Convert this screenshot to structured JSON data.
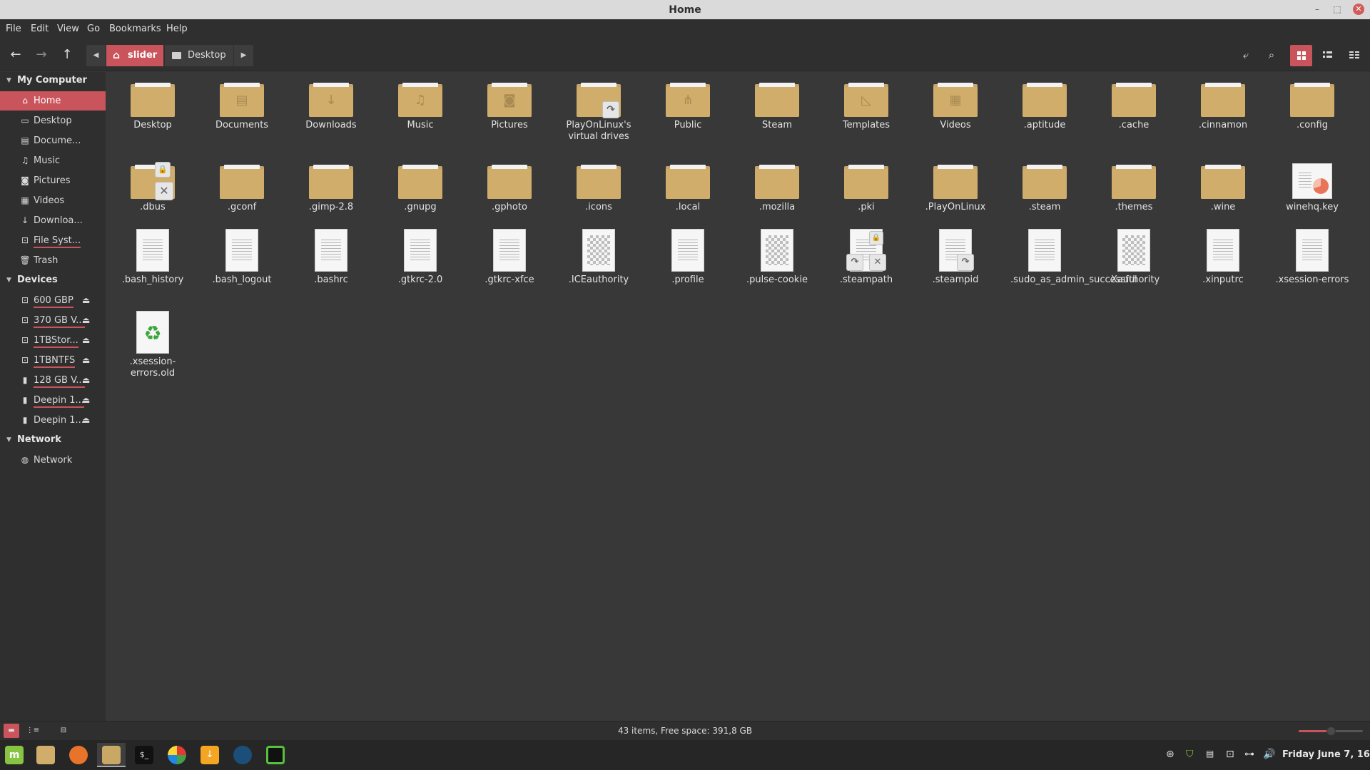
{
  "window": {
    "title": "Home"
  },
  "menu": [
    "File",
    "Edit",
    "View",
    "Go",
    "Bookmarks",
    "Help"
  ],
  "path": {
    "home": "slider",
    "next": "Desktop"
  },
  "sidebar": {
    "sections": {
      "computer": "My Computer",
      "devices": "Devices",
      "network": "Network"
    },
    "computer": [
      {
        "label": "Home",
        "icon": "home-icon"
      },
      {
        "label": "Desktop",
        "icon": "desktop-icon"
      },
      {
        "label": "Docume...",
        "icon": "documents-icon"
      },
      {
        "label": "Music",
        "icon": "music-icon"
      },
      {
        "label": "Pictures",
        "icon": "camera-icon"
      },
      {
        "label": "Videos",
        "icon": "film-icon"
      },
      {
        "label": "Downloa...",
        "icon": "download-icon"
      },
      {
        "label": "File Syst...",
        "icon": "drive-icon"
      },
      {
        "label": "Trash",
        "icon": "trash-icon"
      }
    ],
    "devices": [
      {
        "label": "600 GBP"
      },
      {
        "label": "370 GB V..."
      },
      {
        "label": "1TBStor..."
      },
      {
        "label": "1TBNTFS"
      },
      {
        "label": "128 GB V..."
      },
      {
        "label": "Deepin 1..."
      },
      {
        "label": "Deepin 1..."
      }
    ],
    "network": [
      {
        "label": "Network"
      }
    ]
  },
  "files": {
    "row1": [
      "Desktop",
      "Documents",
      "Downloads",
      "Music",
      "Pictures",
      "PlayOnLinux's virtual drives",
      "Public",
      "Steam",
      "Templates",
      "Videos",
      ".aptitude",
      ".cache",
      ".cinnamon",
      ".config"
    ],
    "row2": [
      ".dbus",
      ".gconf",
      ".gimp-2.8",
      ".gnupg",
      ".gphoto",
      ".icons",
      ".local",
      ".mozilla",
      ".pki",
      ".PlayOnLinux",
      ".steam",
      ".themes",
      ".wine",
      "winehq.key"
    ],
    "row3": [
      ".bash_history",
      ".bash_logout",
      ".bashrc",
      ".gtkrc-2.0",
      ".gtkrc-xfce",
      ".ICEauthority",
      ".profile",
      ".pulse-cookie",
      ".steampath",
      ".steampid",
      ".sudo_as_admin_successful",
      ".Xauthority",
      ".xinputrc",
      ".xsession-errors"
    ],
    "row4": [
      ".xsession-errors.old"
    ]
  },
  "status": {
    "text": "43 items, Free space: 391,8 GB",
    "zoom": 0.5
  },
  "clock": "Friday June  7, 16:42",
  "colors": {
    "accent": "#c9545b",
    "folder": "#d0ad6b"
  }
}
